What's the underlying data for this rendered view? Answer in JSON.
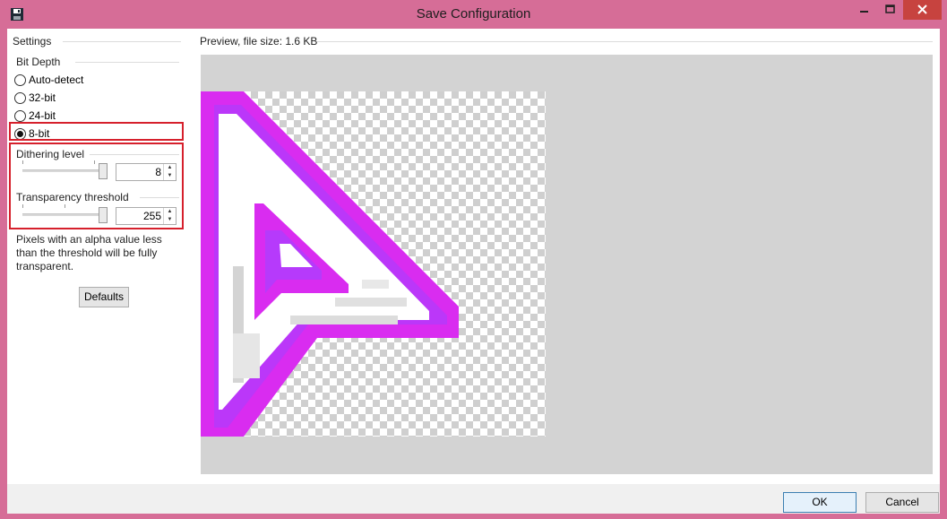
{
  "window": {
    "title": "Save Configuration",
    "icons": {
      "app": "floppy-disk-icon",
      "minimize": "minimize-icon",
      "maximize": "maximize-icon",
      "close": "close-icon"
    },
    "close_color": "#c7433f",
    "frame_color": "#d66d97"
  },
  "settings": {
    "header": "Settings",
    "bit_depth": {
      "header": "Bit Depth",
      "options": [
        {
          "label": "Auto-detect",
          "selected": false
        },
        {
          "label": "32-bit",
          "selected": false
        },
        {
          "label": "24-bit",
          "selected": false
        },
        {
          "label": "8-bit",
          "selected": true
        }
      ]
    },
    "dithering": {
      "label": "Dithering level",
      "value": "8",
      "slider_fraction": 1.0
    },
    "transparency": {
      "label": "Transparency threshold",
      "value": "255",
      "slider_fraction": 1.0
    },
    "info_text": "Pixels with an alpha value less than the threshold will be fully transparent.",
    "defaults_button": "Defaults",
    "highlight_color": "#d6202c"
  },
  "preview": {
    "label": "Preview, file size: 1.6 KB",
    "image": "cursor-arrow-icon",
    "colors": [
      "#ff00e6",
      "#b23cff",
      "#cfcfcf"
    ]
  },
  "footer": {
    "ok": "OK",
    "cancel": "Cancel"
  }
}
